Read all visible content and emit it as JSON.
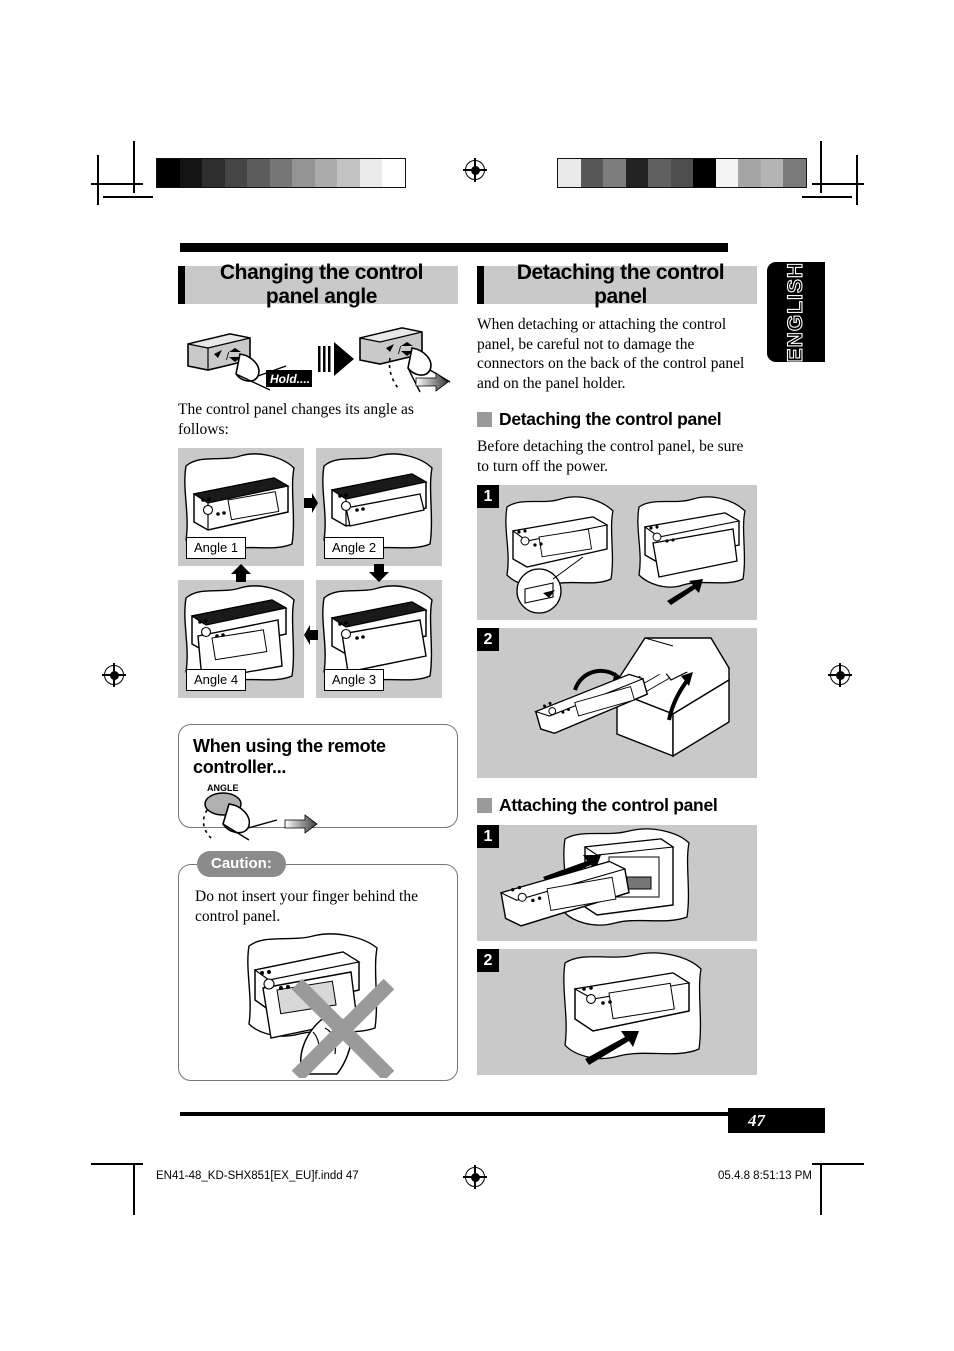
{
  "language_tab": "ENGLISH",
  "left_column": {
    "section_title": "Changing the control panel angle",
    "hold_label": "Hold....",
    "intro_text": "The control panel changes its angle as follows:",
    "angle_panels": [
      {
        "label": "Angle 1"
      },
      {
        "label": "Angle 2"
      },
      {
        "label": "Angle 4"
      },
      {
        "label": "Angle 3"
      }
    ],
    "remote_box": {
      "title": "When using the remote controller...",
      "button_label": "ANGLE"
    },
    "caution_box": {
      "pill_label": "Caution:",
      "text": "Do not insert your finger behind the control panel."
    }
  },
  "right_column": {
    "section_title": "Detaching the control panel",
    "intro_text": "When detaching or attaching the control panel, be careful not to damage the connectors on the back of the control panel and on the panel holder.",
    "detaching": {
      "sub_title": "Detaching the control panel",
      "note": "Before detaching the control panel, be sure to turn off the power.",
      "steps": [
        {
          "number": "1"
        },
        {
          "number": "2"
        }
      ]
    },
    "attaching": {
      "sub_title": "Attaching the control panel",
      "steps": [
        {
          "number": "1"
        },
        {
          "number": "2"
        }
      ]
    }
  },
  "footer": {
    "page_number": "47",
    "file_name": "EN41-48_KD-SHX851[EX_EU]f.indd   47",
    "timestamp": "05.4.8   8:51:13 PM"
  },
  "calibration": {
    "left_bar": [
      "#000000",
      "#141414",
      "#2e2e2e",
      "#454545",
      "#5c5c5c",
      "#777777",
      "#949494",
      "#ababab",
      "#c2c2c2",
      "#ebebeb",
      "#ffffff"
    ],
    "right_bar": [
      "#eaeaea",
      "#585858",
      "#7d7d7d",
      "#232323",
      "#616161",
      "#4d4d4d",
      "#000000",
      "#f4f4f4",
      "#a5a5a5",
      "#b4b4b4",
      "#7a7a7a"
    ]
  }
}
